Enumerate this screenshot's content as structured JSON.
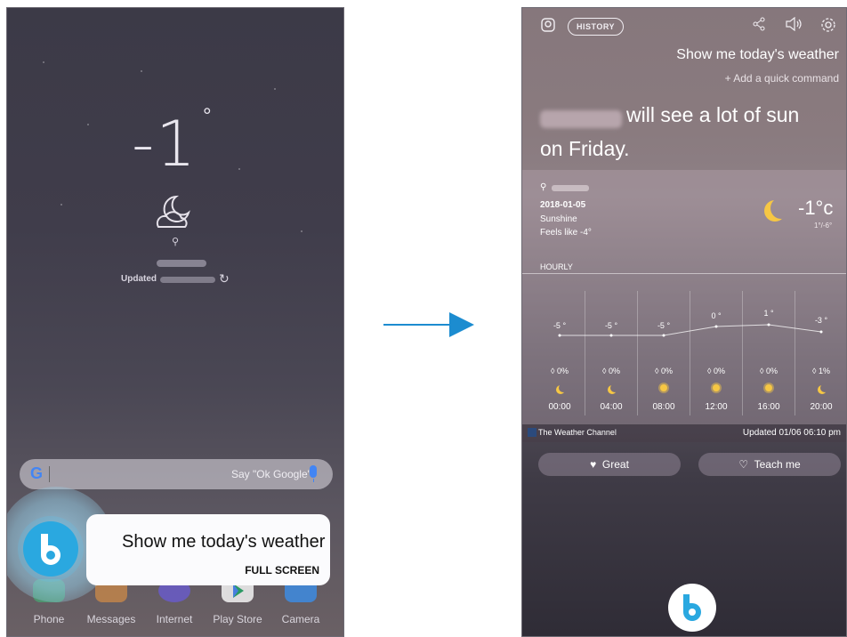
{
  "left_screen": {
    "temperature": "-1",
    "degree_symbol": "°",
    "updated_label": "Updated",
    "search": {
      "logo": "G",
      "placeholder": "Say \"Ok Google\""
    },
    "bixby_popup": {
      "text": "Show me today's weather",
      "action": "FULL SCREEN"
    },
    "dock": [
      {
        "label": "Phone",
        "icon": "phone-icon",
        "color": "#3cc07a"
      },
      {
        "label": "Messages",
        "icon": "messages-icon",
        "color": "#f2993e"
      },
      {
        "label": "Internet",
        "icon": "internet-icon",
        "color": "#6a5bd6"
      },
      {
        "label": "Play Store",
        "icon": "play-store-icon",
        "color": "#ffffff"
      },
      {
        "label": "Camera",
        "icon": "camera-icon",
        "color": "#3b8ee8"
      }
    ]
  },
  "right_screen": {
    "history_label": "HISTORY",
    "query": "Show me today's weather",
    "quick_command": "+ Add a quick command",
    "response_line1": "will see a lot of sun",
    "response_line2": "on Friday.",
    "weather": {
      "date": "2018-01-05",
      "condition": "Sunshine",
      "feels_like": "Feels like -4°",
      "current_temp": "-1°c",
      "range": "1°/-6°"
    },
    "hourly_label": "HOURLY",
    "hourly": [
      {
        "temp": "-5 °",
        "precip": "0%",
        "icon": "moon-icon",
        "time": "00:00"
      },
      {
        "temp": "-5 °",
        "precip": "0%",
        "icon": "moon-icon",
        "time": "04:00"
      },
      {
        "temp": "-5 °",
        "precip": "0%",
        "icon": "sun-icon",
        "time": "08:00"
      },
      {
        "temp": "0 °",
        "precip": "0%",
        "icon": "sun-icon",
        "time": "12:00"
      },
      {
        "temp": "1 °",
        "precip": "0%",
        "icon": "sun-icon",
        "time": "16:00"
      },
      {
        "temp": "-3 °",
        "precip": "1%",
        "icon": "moon-icon",
        "time": "20:00"
      }
    ],
    "provider": "The Weather Channel",
    "updated": "Updated 01/06 06:10 pm",
    "feedback": {
      "great": "Great",
      "teach": "Teach me"
    }
  },
  "colors": {
    "arrow": "#1c8cd0",
    "bixby": "#2aa8e0",
    "sun": "#f6c744"
  }
}
